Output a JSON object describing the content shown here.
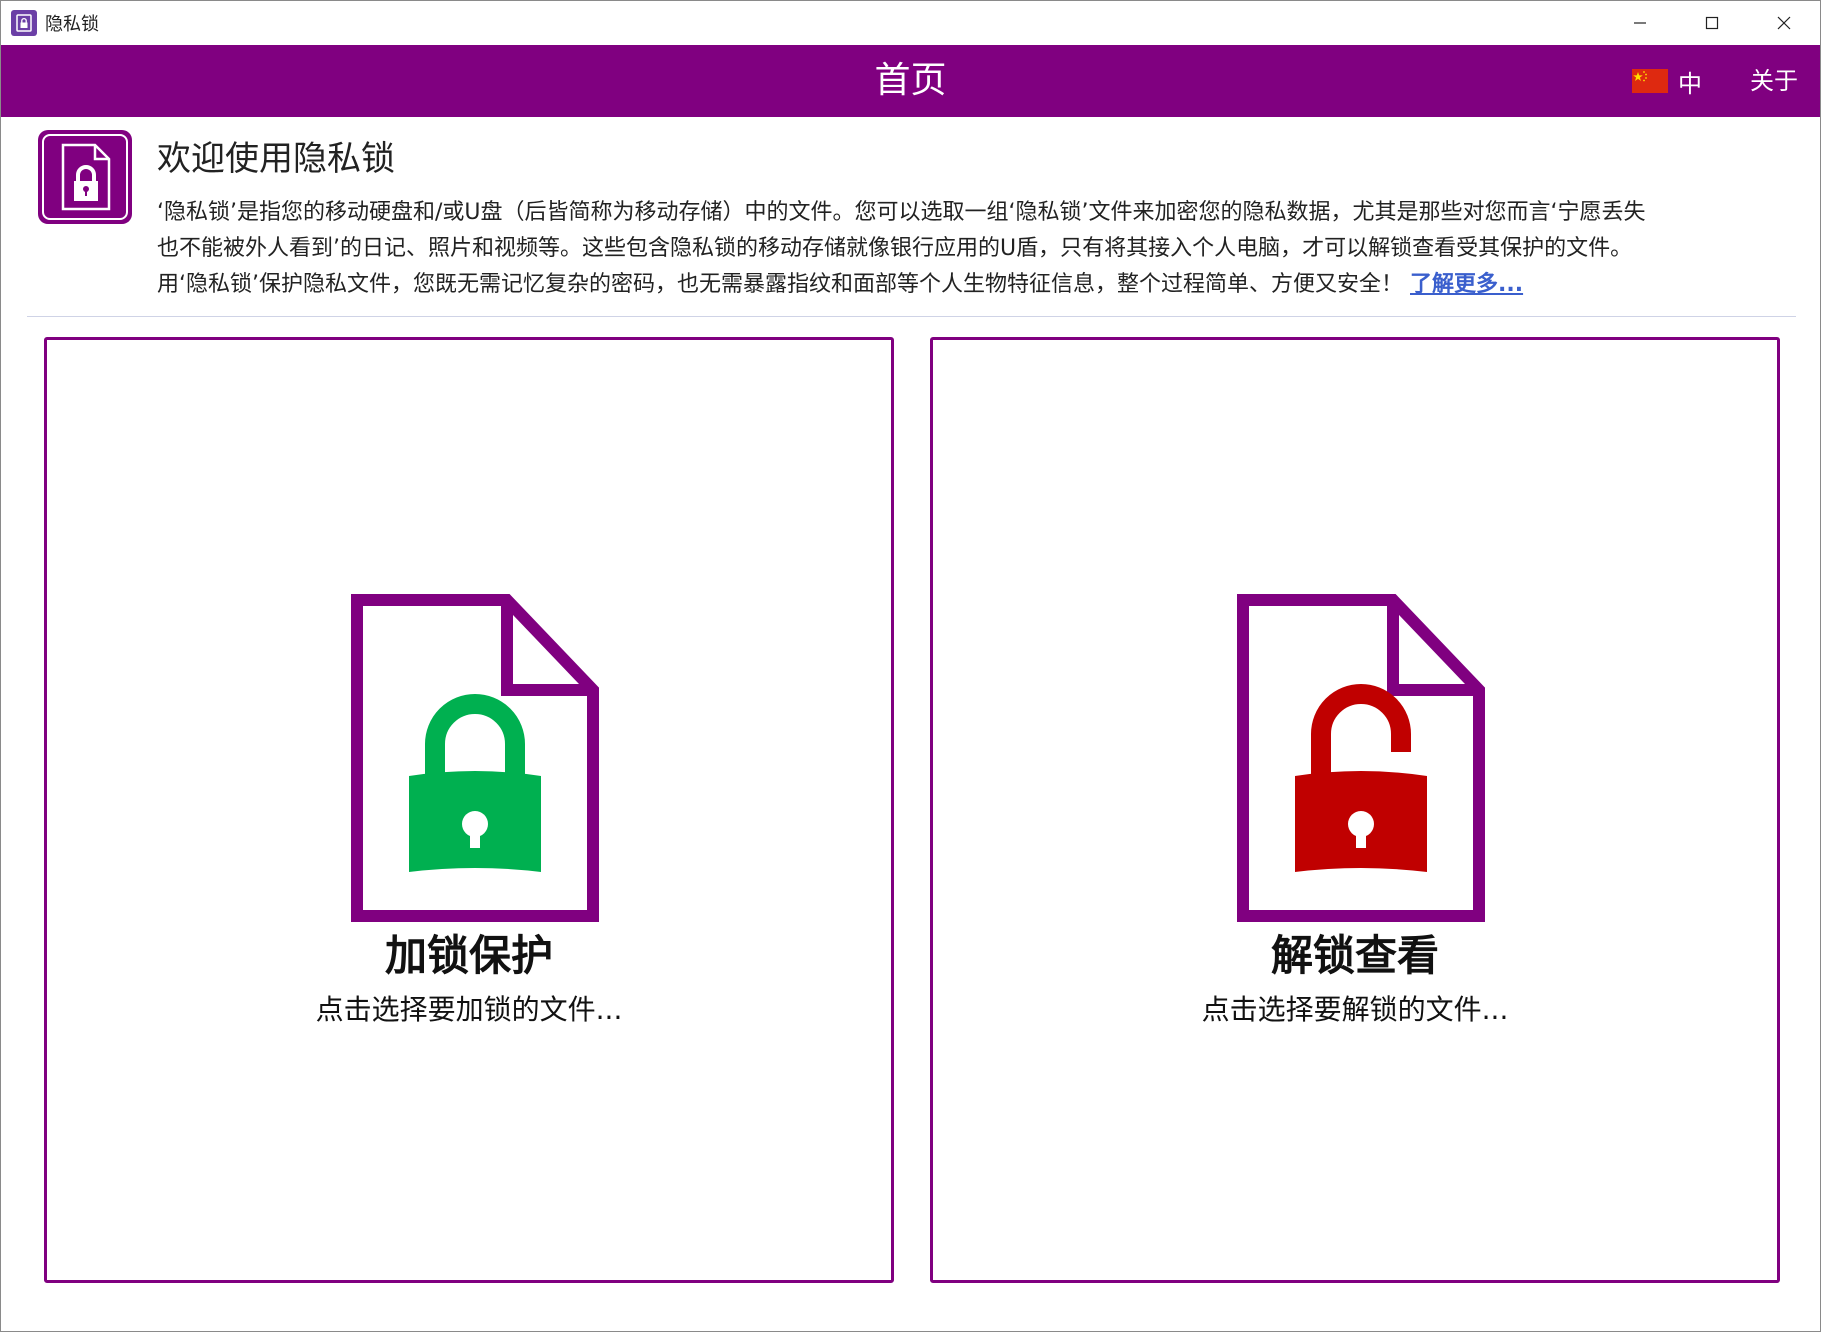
{
  "window": {
    "title": "隐私锁"
  },
  "header": {
    "title": "首页",
    "language_label": "中",
    "about_label": "关于"
  },
  "intro": {
    "title": "欢迎使用隐私锁",
    "line1": "‘隐私锁’是指您的移动硬盘和/或U盘（后皆简称为移动存储）中的文件。您可以选取一组‘隐私锁’文件来加密您的隐私数据，尤其是那些对您而言‘宁愿丢失",
    "line2": "也不能被外人看到’的日记、照片和视频等。这些包含隐私锁的移动存储就像银行应用的U盾，只有将其接入个人电脑，才可以解锁查看受其保护的文件。",
    "line3": "用‘隐私锁’保护隐私文件，您既无需记忆复杂的密码，也无需暴露指纹和面部等个人生物特征信息，整个过程简单、方便又安全！",
    "learn_more": "了解更多..."
  },
  "cards": {
    "lock": {
      "title": "加锁保护",
      "subtitle": "点击选择要加锁的文件..."
    },
    "unlock": {
      "title": "解锁查看",
      "subtitle": "点击选择要解锁的文件..."
    }
  },
  "colors": {
    "brand": "#800080",
    "lock_green": "#00b050",
    "unlock_red": "#c00000",
    "link_blue": "#3a5fcd"
  },
  "icons": {
    "app": "lock-file-icon",
    "lock": "locked-padlock-icon",
    "unlock": "unlocked-padlock-icon",
    "flag": "china-flag-icon"
  }
}
